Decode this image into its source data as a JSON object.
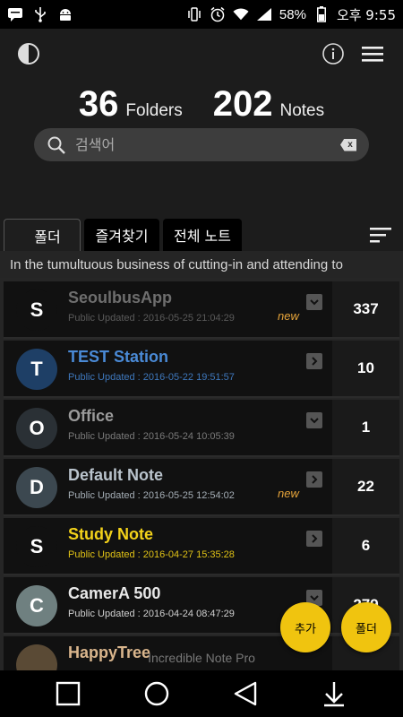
{
  "status_bar": {
    "battery": "58%",
    "time": "오후 9:55"
  },
  "header": {
    "folders_count": "36",
    "folders_label": "Folders",
    "notes_count": "202",
    "notes_label": "Notes"
  },
  "search": {
    "placeholder": "검색어",
    "clear_label": "x"
  },
  "tabs": [
    {
      "label": "폴더",
      "active": true
    },
    {
      "label": "즐겨찾기",
      "active": false
    },
    {
      "label": "전체 노트",
      "active": false
    }
  ],
  "marquee_text": "In the tumultuous business of cutting-in and attending to",
  "items": [
    {
      "initial": "S",
      "title": "SeoulbusApp",
      "date": "Public Updated : 2016-05-25 21:04:29",
      "new": "new",
      "count": "337",
      "title_color": "#6e6e6e",
      "date_color": "#5a5a5a",
      "avatar_color": "#111111",
      "expand": "chevron-down"
    },
    {
      "initial": "T",
      "title": "TEST Station",
      "date": "Public Updated : 2016-05-22 19:51:57",
      "new": "",
      "count": "10",
      "title_color": "#4a8ad6",
      "date_color": "#3e78bd",
      "avatar_color": "#1e3f66",
      "expand": "chevron-right"
    },
    {
      "initial": "O",
      "title": "Office",
      "date": "Public Updated : 2016-05-24 10:05:39",
      "new": "",
      "count": "1",
      "title_color": "#9a9a9a",
      "date_color": "#7a7a7a",
      "avatar_color": "#2a3035",
      "expand": "chevron-down"
    },
    {
      "initial": "D",
      "title": "Default Note",
      "date": "Public Updated : 2016-05-25 12:54:02",
      "new": "new",
      "count": "22",
      "title_color": "#b9c3cc",
      "date_color": "#a4adb5",
      "avatar_color": "#3c4850",
      "expand": "chevron-right"
    },
    {
      "initial": "S",
      "title": "Study Note",
      "date": "Public Updated : 2016-04-27 15:35:28",
      "new": "",
      "count": "6",
      "title_color": "#f3d21a",
      "date_color": "#e0c216",
      "avatar_color": "#111111",
      "expand": "chevron-right"
    },
    {
      "initial": "C",
      "title": "CamerA 500",
      "date": "Public Updated : 2016-04-24 08:47:29",
      "new": "",
      "count": "279",
      "title_color": "#e8e8e8",
      "date_color": "#d0d0d0",
      "avatar_color": "#6f8080",
      "expand": "chevron-down"
    },
    {
      "initial": "",
      "title": "HappyTree",
      "date": "",
      "new": "",
      "count": "",
      "title_color": "#d9b58c",
      "date_color": "#b08f6c",
      "avatar_color": "#5a4a35",
      "expand": ""
    }
  ],
  "footer_label": "Incredible Note Pro",
  "fab": {
    "add_label": "추가",
    "folder_label": "폴더"
  },
  "colors": {
    "accent": "#f0c40f",
    "background": "#1c1c1c"
  }
}
